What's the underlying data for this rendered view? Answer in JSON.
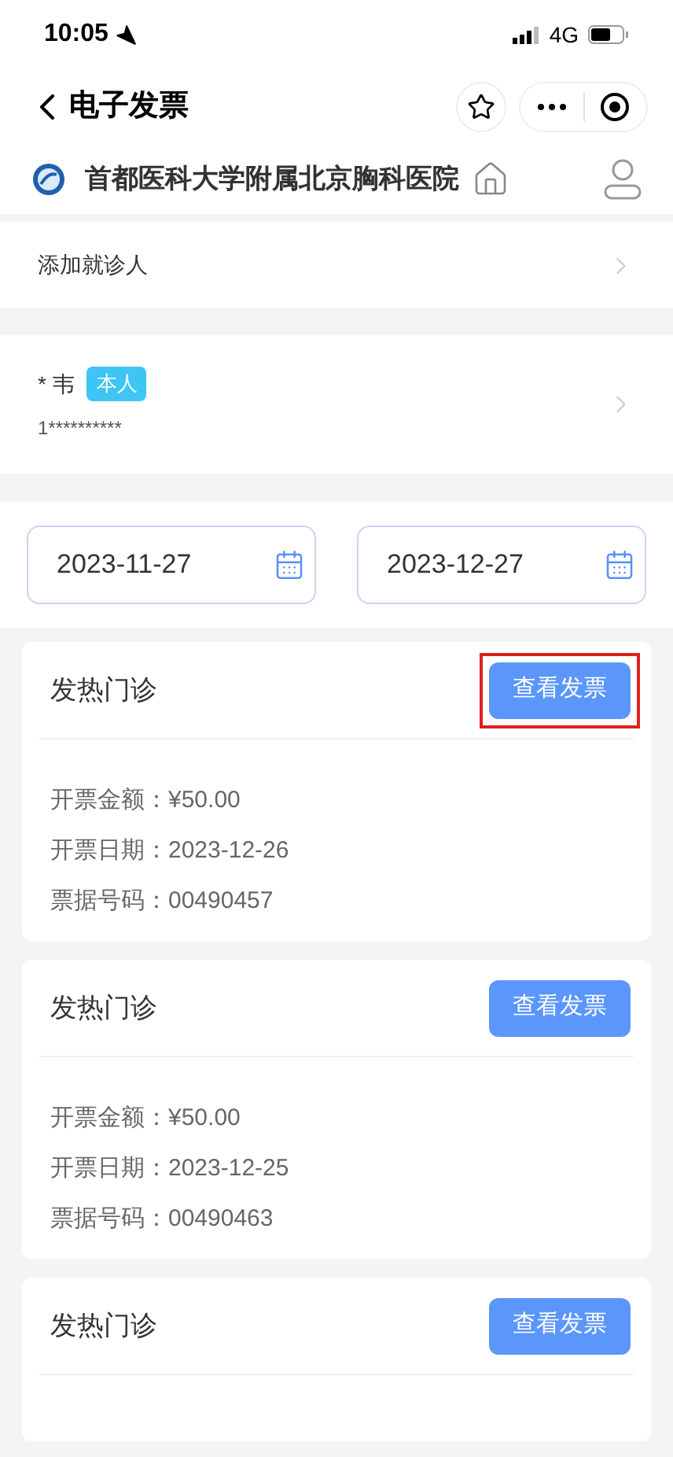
{
  "status_bar": {
    "time": "10:05",
    "network": "4G"
  },
  "nav": {
    "title": "电子发票"
  },
  "hospital": {
    "name": "首都医科大学附属北京胸科医院"
  },
  "add_patient": {
    "label": "添加就诊人"
  },
  "patient": {
    "name": "* 韦",
    "tag": "本人",
    "id": "1**********"
  },
  "date_range": {
    "start": "2023-11-27",
    "end": "2023-12-27"
  },
  "invoices": [
    {
      "department": "发热门诊",
      "button": "查看发票",
      "highlighted": true,
      "details": [
        "开票金额：¥50.00",
        "开票日期：2023-12-26",
        "票据号码：00490457"
      ]
    },
    {
      "department": "发热门诊",
      "button": "查看发票",
      "highlighted": false,
      "details": [
        "开票金额：¥50.00",
        "开票日期：2023-12-25",
        "票据号码：00490463"
      ]
    },
    {
      "department": "发热门诊",
      "button": "查看发票",
      "highlighted": false
    }
  ]
}
